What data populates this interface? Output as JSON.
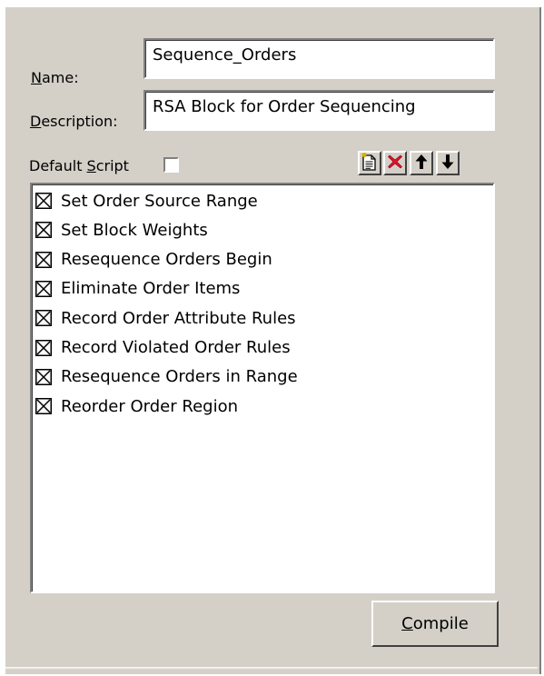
{
  "form": {
    "name_label_prefix": "N",
    "name_label_rest": "ame:",
    "name_value": "Sequence_Orders",
    "description_label_prefix": "D",
    "description_label_rest": "escription:",
    "description_value": "RSA Block for Order Sequencing",
    "default_script_label_pre": "Default ",
    "default_script_label_ul": "S",
    "default_script_label_post": "cript",
    "default_script_checked": false
  },
  "toolbar": {
    "icons": [
      "new-item-icon",
      "delete-icon",
      "move-up-icon",
      "move-down-icon"
    ]
  },
  "script_steps": [
    {
      "label": "Set Order Source Range",
      "checked": true
    },
    {
      "label": "Set Block Weights",
      "checked": true
    },
    {
      "label": "Resequence Orders Begin",
      "checked": true
    },
    {
      "label": "Eliminate Order Items",
      "checked": true
    },
    {
      "label": "Record Order Attribute Rules",
      "checked": true
    },
    {
      "label": "Record Violated Order Rules",
      "checked": true
    },
    {
      "label": "Resequence Orders in Range",
      "checked": true
    },
    {
      "label": "Reorder Order Region",
      "checked": true
    }
  ],
  "compile_button": {
    "label_ul": "C",
    "label_rest": "ompile"
  }
}
